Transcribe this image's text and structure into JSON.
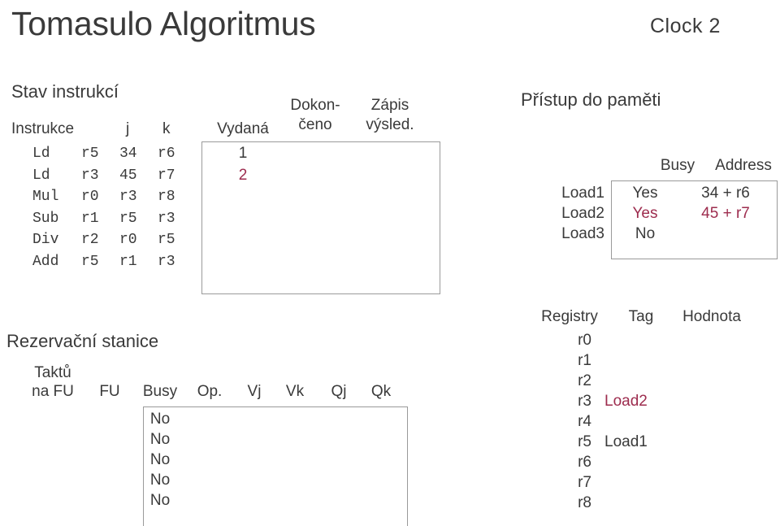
{
  "title": "Tomasulo Algoritmus",
  "clock": "Clock  2",
  "accent_color": "#9d2c4e",
  "text_color": "#3a3a3a",
  "instruction_status": {
    "heading": "Stav instrukcí",
    "columns": {
      "instruction": "Instrukce",
      "j": "j",
      "k": "k",
      "issue": "Vydaná",
      "exec_l1": "Dokon-",
      "exec_l2": "čeno",
      "write_l1": "Zápis",
      "write_l2": "výsled."
    },
    "rows": [
      {
        "op": "Ld",
        "dest": "r5",
        "j": "34",
        "k": "r6",
        "issue": "1",
        "exec": "",
        "write": "",
        "highlight": false
      },
      {
        "op": "Ld",
        "dest": "r3",
        "j": "45",
        "k": "r7",
        "issue": "2",
        "exec": "",
        "write": "",
        "highlight": true
      },
      {
        "op": "Mul",
        "dest": "r0",
        "j": "r3",
        "k": "r8",
        "issue": "",
        "exec": "",
        "write": "",
        "highlight": false
      },
      {
        "op": "Sub",
        "dest": "r1",
        "j": "r5",
        "k": "r3",
        "issue": "",
        "exec": "",
        "write": "",
        "highlight": false
      },
      {
        "op": "Div",
        "dest": "r2",
        "j": "r0",
        "k": "r5",
        "issue": "",
        "exec": "",
        "write": "",
        "highlight": false
      },
      {
        "op": "Add",
        "dest": "r5",
        "j": "r1",
        "k": "r3",
        "issue": "",
        "exec": "",
        "write": "",
        "highlight": false
      }
    ]
  },
  "reservation_stations": {
    "heading": "Rezervační stanice",
    "columns": {
      "ticks_l1": "Taktů",
      "ticks_l2": "na FU",
      "fu": "FU",
      "busy": "Busy",
      "op": "Op.",
      "vj": "Vj",
      "vk": "Vk",
      "qj": "Qj",
      "qk": "Qk"
    },
    "rows": [
      {
        "ticks": "",
        "fu": "",
        "busy": "No",
        "op": "",
        "vj": "",
        "vk": "",
        "qj": "",
        "qk": ""
      },
      {
        "ticks": "",
        "fu": "",
        "busy": "No",
        "op": "",
        "vj": "",
        "vk": "",
        "qj": "",
        "qk": ""
      },
      {
        "ticks": "",
        "fu": "",
        "busy": "No",
        "op": "",
        "vj": "",
        "vk": "",
        "qj": "",
        "qk": ""
      },
      {
        "ticks": "",
        "fu": "",
        "busy": "No",
        "op": "",
        "vj": "",
        "vk": "",
        "qj": "",
        "qk": ""
      },
      {
        "ticks": "",
        "fu": "",
        "busy": "No",
        "op": "",
        "vj": "",
        "vk": "",
        "qj": "",
        "qk": ""
      }
    ]
  },
  "memory_access": {
    "heading": "Přístup do paměti",
    "columns": {
      "busy": "Busy",
      "address": "Address"
    },
    "rows": [
      {
        "name": "Load1",
        "busy": "Yes",
        "address": "34 + r6",
        "highlight": false
      },
      {
        "name": "Load2",
        "busy": "Yes",
        "address": "45 + r7",
        "highlight": true
      },
      {
        "name": "Load3",
        "busy": "No",
        "address": "",
        "highlight": false
      }
    ]
  },
  "register_status": {
    "columns": {
      "register": "Registry",
      "tag": "Tag",
      "value": "Hodnota"
    },
    "rows": [
      {
        "name": "r0",
        "tag": "",
        "value": "",
        "highlight": false
      },
      {
        "name": "r1",
        "tag": "",
        "value": "",
        "highlight": false
      },
      {
        "name": "r2",
        "tag": "",
        "value": "",
        "highlight": false
      },
      {
        "name": "r3",
        "tag": "Load2",
        "value": "",
        "highlight": true
      },
      {
        "name": "r4",
        "tag": "",
        "value": "",
        "highlight": false
      },
      {
        "name": "r5",
        "tag": "Load1",
        "value": "",
        "highlight": false
      },
      {
        "name": "r6",
        "tag": "",
        "value": "",
        "highlight": false
      },
      {
        "name": "r7",
        "tag": "",
        "value": "",
        "highlight": false
      },
      {
        "name": "r8",
        "tag": "",
        "value": "",
        "highlight": false
      }
    ]
  }
}
